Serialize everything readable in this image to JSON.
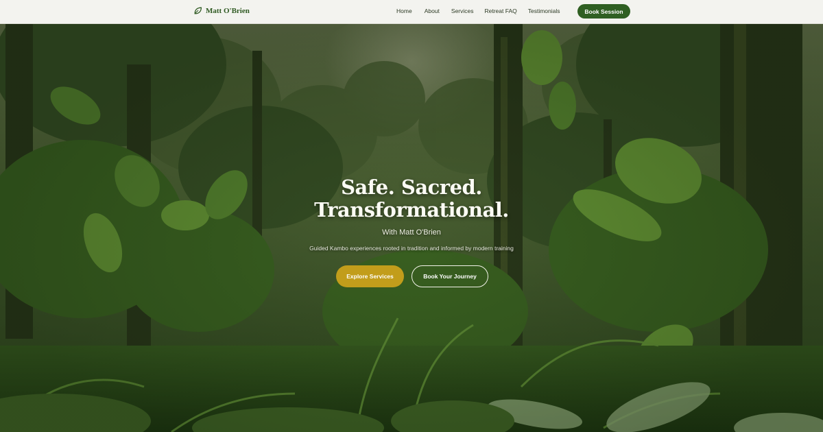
{
  "header": {
    "brand": "Matt O'Brien",
    "nav": [
      "Home",
      "About",
      "Services",
      "Retreat FAQ",
      "Testimonials"
    ],
    "cta": "Book Session"
  },
  "hero": {
    "headline_line1": "Safe. Sacred.",
    "headline_line2": "Transformational.",
    "with": "With Matt O'Brien",
    "subtitle": "Guided Kambo experiences rooted in tradition and informed by modern training",
    "primary_button": "Explore Services",
    "secondary_button": "Book Your Journey"
  },
  "colors": {
    "header_bg": "#f3f3ef",
    "brand": "#2f5a22",
    "cta_bg": "#2f5f22",
    "primary_button_bg": "#c29d1b"
  },
  "icons": {
    "brand": "leaf-icon"
  }
}
